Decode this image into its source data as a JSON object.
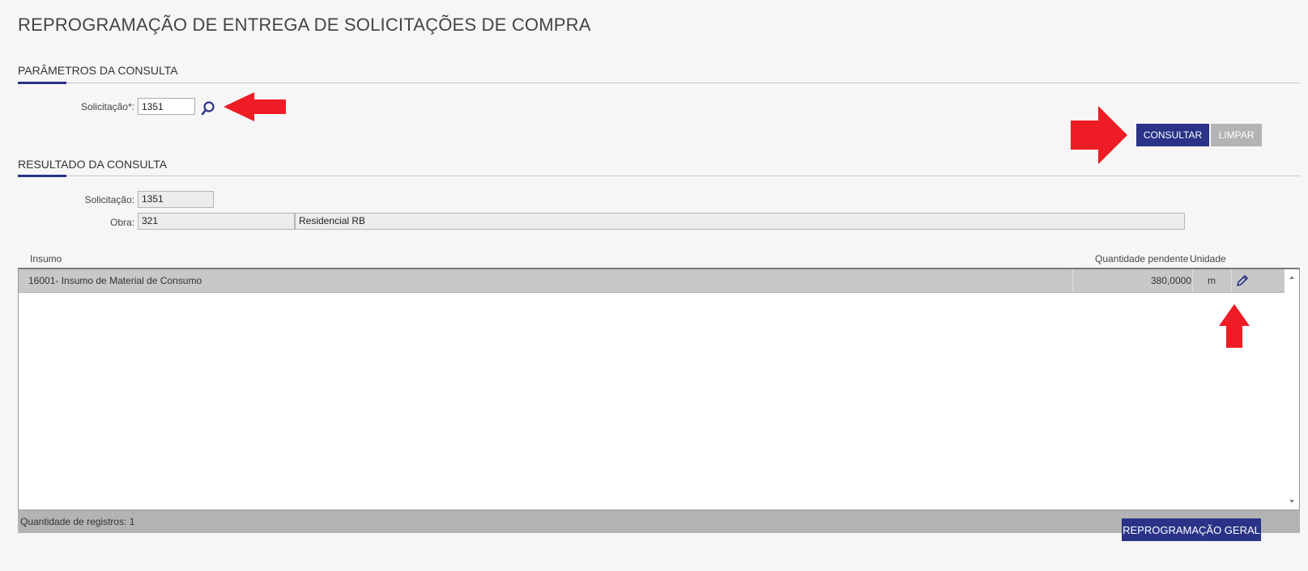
{
  "page": {
    "title": "REPROGRAMAÇÃO DE ENTREGA DE SOLICITAÇÕES DE COMPRA"
  },
  "params": {
    "section_title": "PARÂMETROS DA CONSULTA",
    "solicitacao_label": "Solicitação*:",
    "solicitacao_value": "1351",
    "search_icon": "search-icon",
    "consultar_label": "CONSULTAR",
    "limpar_label": "LIMPAR"
  },
  "result": {
    "section_title": "RESULTADO DA CONSULTA",
    "solicitacao_label": "Solicitação:",
    "solicitacao_value": "1351",
    "obra_label": "Obra:",
    "obra_code": "321",
    "obra_name": "Residencial RB"
  },
  "grid": {
    "columns": {
      "insumo": "Insumo",
      "quantidade": "Quantidade pendente",
      "unidade": "Unidade"
    },
    "rows": [
      {
        "insumo": "16001- Insumo de Material de Consumo",
        "quantidade": "380,0000",
        "unidade": "m",
        "action_icon": "pencil-icon"
      }
    ],
    "footer_label": "Quantidade de registros:",
    "footer_count": "1"
  },
  "actions": {
    "reprogramacao_geral_label": "REPROGRAMAÇÃO GERAL"
  },
  "colors": {
    "primary": "#2a3388",
    "annotation_arrow": "#ee1c25",
    "gray_button": "#b3b3b3"
  }
}
